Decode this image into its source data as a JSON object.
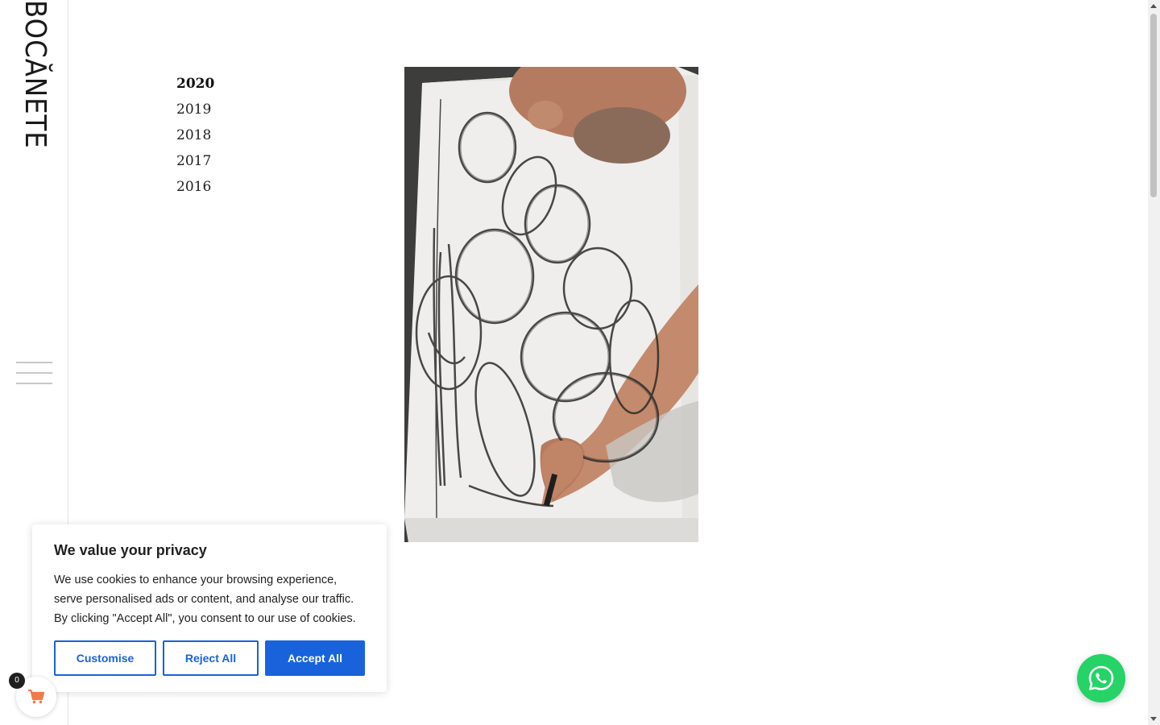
{
  "brand": {
    "logo_text": "BOCĂNETE"
  },
  "years": [
    "2020",
    "2019",
    "2018",
    "2017",
    "2016"
  ],
  "active_year": "2020",
  "artwork": {
    "alt": "artist drawing charcoal circles on a white canvas"
  },
  "cookie_banner": {
    "title": "We value your privacy",
    "body": "We use cookies to enhance your browsing experience, serve personalised ads or content, and analyse our traffic. By clicking \"Accept All\", you consent to our use of cookies.",
    "customise_label": "Customise",
    "reject_label": "Reject All",
    "accept_label": "Accept All",
    "accent_color": "#1863dc"
  },
  "cart": {
    "count": "0",
    "icon": "cart-icon",
    "icon_color": "#f07b4a"
  },
  "whatsapp": {
    "icon": "whatsapp-icon",
    "color": "#25d366"
  },
  "menu": {
    "icon": "hamburger-icon"
  }
}
